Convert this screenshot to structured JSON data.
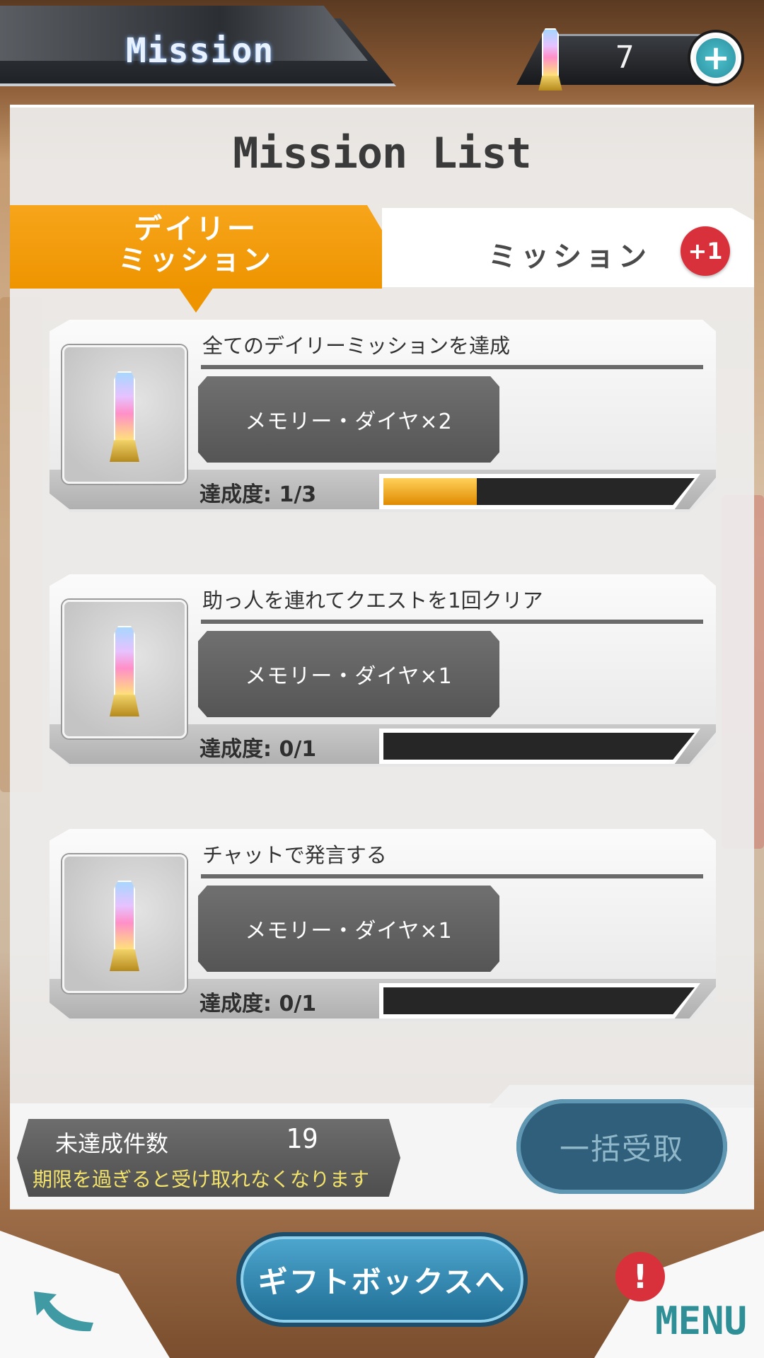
{
  "header": {
    "title": "Mission",
    "currency_value": "7",
    "currency_icon": "memory-diamond-icon",
    "add_icon": "plus-icon"
  },
  "panel": {
    "title": "Mission List"
  },
  "tabs": [
    {
      "label": "デイリー\nミッション",
      "active": true
    },
    {
      "label": "ミッション",
      "active": false,
      "badge": "+1"
    }
  ],
  "missions": [
    {
      "title": "全てのデイリーミッションを達成",
      "reward": "メモリー・ダイヤ×2",
      "progress_label": "達成度: 1/3",
      "progress": 0.3333
    },
    {
      "title": "助っ人を連れてクエストを1回クリア",
      "reward": "メモリー・ダイヤ×1",
      "progress_label": "達成度: 0/1",
      "progress": 0
    },
    {
      "title": "チャットで発言する",
      "reward": "メモリー・ダイヤ×1",
      "progress_label": "達成度: 0/1",
      "progress": 0
    }
  ],
  "status": {
    "uncleared_label": "未達成件数",
    "uncleared_count": "19",
    "expiry_note": "期限を過ぎると受け取れなくなります",
    "receive_all_label": "一括受取"
  },
  "footer": {
    "gift_box_label": "ギフトボックスへ",
    "alert_badge": "!",
    "menu_label": "MENU"
  },
  "colors": {
    "accent_orange": "#EE9400",
    "badge_red": "#D9313C",
    "button_blue": "#2F5F7A",
    "menu_teal": "#2E8F97"
  }
}
